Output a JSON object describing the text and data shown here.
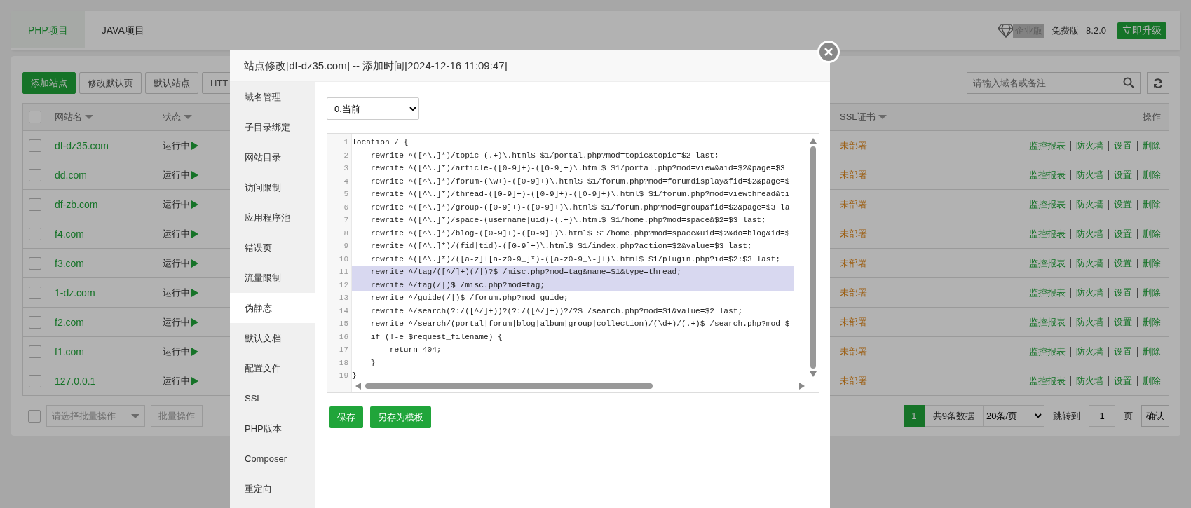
{
  "top_tabs": [
    {
      "label": "PHP项目",
      "selected": true
    },
    {
      "label": "JAVA项目",
      "selected": false
    }
  ],
  "edition": {
    "badge": "企业版",
    "plan": "免费版",
    "version": "8.2.0",
    "upgrade_button": "立即升级"
  },
  "toolbar": {
    "buttons": [
      {
        "label": "添加站点",
        "kind": "primary"
      },
      {
        "label": "修改默认页",
        "kind": "default"
      },
      {
        "label": "默认站点",
        "kind": "default"
      },
      {
        "label": "HTT",
        "kind": "default"
      }
    ],
    "search": {
      "placeholder": "请输入域名或备注"
    }
  },
  "table": {
    "all_checked": false,
    "columns": [
      {
        "label": "网站名",
        "sortable": true
      },
      {
        "label": "状态",
        "sortable": true
      },
      {
        "label": "SSL证书",
        "sortable": true
      },
      {
        "label": "操作",
        "sortable": false
      }
    ],
    "rows": [
      {
        "checked": false,
        "name": "df-dz35.com",
        "status": "运行中",
        "ssl": "未部署",
        "actions": [
          "监控报表",
          "防火墙",
          "设置",
          "删除"
        ]
      },
      {
        "checked": false,
        "name": "dd.com",
        "status": "运行中",
        "ssl": "未部署",
        "actions": [
          "监控报表",
          "防火墙",
          "设置",
          "删除"
        ]
      },
      {
        "checked": false,
        "name": "df-zb.com",
        "status": "运行中",
        "ssl": "未部署",
        "actions": [
          "监控报表",
          "防火墙",
          "设置",
          "删除"
        ]
      },
      {
        "checked": false,
        "name": "f4.com",
        "status": "运行中",
        "ssl": "未部署",
        "actions": [
          "监控报表",
          "防火墙",
          "设置",
          "删除"
        ]
      },
      {
        "checked": false,
        "name": "f3.com",
        "status": "运行中",
        "ssl": "未部署",
        "actions": [
          "监控报表",
          "防火墙",
          "设置",
          "删除"
        ]
      },
      {
        "checked": false,
        "name": "1-dz.com",
        "status": "运行中",
        "ssl": "未部署",
        "actions": [
          "监控报表",
          "防火墙",
          "设置",
          "删除"
        ]
      },
      {
        "checked": false,
        "name": "f2.com",
        "status": "运行中",
        "ssl": "未部署",
        "actions": [
          "监控报表",
          "防火墙",
          "设置",
          "删除"
        ]
      },
      {
        "checked": false,
        "name": "f1.com",
        "status": "运行中",
        "ssl": "未部署",
        "actions": [
          "监控报表",
          "防火墙",
          "设置",
          "删除"
        ]
      },
      {
        "checked": false,
        "name": "127.0.0.1",
        "status": "运行中",
        "ssl": "未部署",
        "actions": [
          "监控报表",
          "防火墙",
          "设置",
          "删除"
        ]
      }
    ]
  },
  "batch": {
    "checked": false,
    "select_placeholder": "请选择批量操作",
    "button": "批量操作"
  },
  "pagination": {
    "pages": [
      {
        "label": "1",
        "selected": true
      }
    ],
    "total": "共9条数据",
    "page_size": "20条/页",
    "jump_label": "跳转到",
    "jump_value": "1",
    "page_unit": "页",
    "confirm": "确认"
  },
  "modal": {
    "title": "站点修改[df-dz35.com] -- 添加时间[2024-12-16 11:09:47]",
    "menu": [
      {
        "label": "域名管理",
        "selected": false
      },
      {
        "label": "子目录绑定",
        "selected": false
      },
      {
        "label": "网站目录",
        "selected": false
      },
      {
        "label": "访问限制",
        "selected": false
      },
      {
        "label": "应用程序池",
        "selected": false
      },
      {
        "label": "错误页",
        "selected": false
      },
      {
        "label": "流量限制",
        "selected": false
      },
      {
        "label": "伪静态",
        "selected": true
      },
      {
        "label": "默认文档",
        "selected": false
      },
      {
        "label": "配置文件",
        "selected": false
      },
      {
        "label": "SSL",
        "selected": false
      },
      {
        "label": "PHP版本",
        "selected": false
      },
      {
        "label": "Composer",
        "selected": false
      },
      {
        "label": "重定向",
        "selected": false
      }
    ],
    "version_select": "0.当前",
    "code_lines": [
      {
        "number": "1",
        "text": "location / {",
        "selected": false
      },
      {
        "number": "2",
        "text": "    rewrite ^([^\\.]*)/topic-(.+)\\.html$ $1/portal.php?mod=topic&topic=$2 last;",
        "selected": false
      },
      {
        "number": "3",
        "text": "    rewrite ^([^\\.]*)/article-([0-9]+)-([0-9]+)\\.html$ $1/portal.php?mod=view&aid=$2&page=$3",
        "selected": false
      },
      {
        "number": "4",
        "text": "    rewrite ^([^\\.]*)/forum-(\\w+)-([0-9]+)\\.html$ $1/forum.php?mod=forumdisplay&fid=$2&page=$",
        "selected": false
      },
      {
        "number": "5",
        "text": "    rewrite ^([^\\.]*)/thread-([0-9]+)-([0-9]+)-([0-9]+)\\.html$ $1/forum.php?mod=viewthread&ti",
        "selected": false
      },
      {
        "number": "6",
        "text": "    rewrite ^([^\\.]*)/group-([0-9]+)-([0-9]+)\\.html$ $1/forum.php?mod=group&fid=$2&page=$3 la",
        "selected": false
      },
      {
        "number": "7",
        "text": "    rewrite ^([^\\.]*)/space-(username|uid)-(.+)\\.html$ $1/home.php?mod=space&$2=$3 last;",
        "selected": false
      },
      {
        "number": "8",
        "text": "    rewrite ^([^\\.]*)/blog-([0-9]+)-([0-9]+)\\.html$ $1/home.php?mod=space&uid=$2&do=blog&id=$",
        "selected": false
      },
      {
        "number": "9",
        "text": "    rewrite ^([^\\.]*)/(fid|tid)-([0-9]+)\\.html$ $1/index.php?action=$2&value=$3 last;",
        "selected": false
      },
      {
        "number": "10",
        "text": "    rewrite ^([^\\.]*)/([a-z]+[a-z0-9_]*)-([a-z0-9_\\-]+)\\.html$ $1/plugin.php?id=$2:$3 last;",
        "selected": false
      },
      {
        "number": "11",
        "text": "    rewrite ^/tag/([^/]+)(/|)?$ /misc.php?mod=tag&name=$1&type=thread;",
        "selected": true
      },
      {
        "number": "12",
        "text": "    rewrite ^/tag(/|)$ /misc.php?mod=tag;",
        "selected": true
      },
      {
        "number": "13",
        "text": "    rewrite ^/guide(/|)$ /forum.php?mod=guide;",
        "selected": false
      },
      {
        "number": "14",
        "text": "    rewrite ^/search(?:/([^/]+))?(?:/([^/]+))?/?$ /search.php?mod=$1&value=$2 last;",
        "selected": false
      },
      {
        "number": "15",
        "text": "    rewrite ^/search/(portal|forum|blog|album|group|collection)/(\\d+)/(.+)$ /search.php?mod=$",
        "selected": false
      },
      {
        "number": "16",
        "text": "    if (!-e $request_filename) {",
        "selected": false
      },
      {
        "number": "17",
        "text": "        return 404;",
        "selected": false
      },
      {
        "number": "18",
        "text": "    }",
        "selected": false
      },
      {
        "number": "19",
        "text": "}",
        "selected": false
      }
    ],
    "buttons": [
      "保存",
      "另存为模板"
    ]
  }
}
